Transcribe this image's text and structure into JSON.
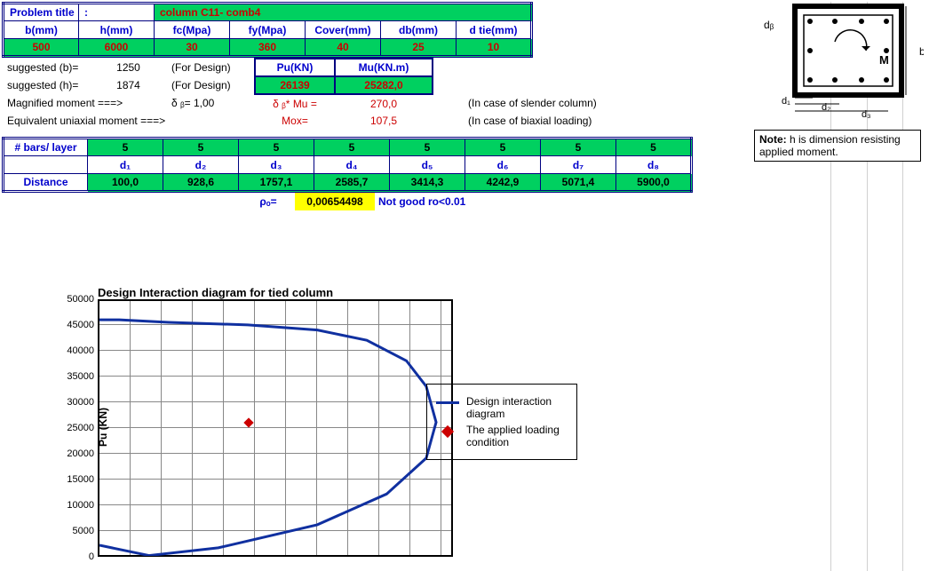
{
  "header": {
    "problem_label": "Problem title",
    "colon": ":",
    "problem_value": "column C11- comb4",
    "cols": [
      "b(mm)",
      "h(mm)",
      "fc(Mpa)",
      "fy(Mpa)",
      "Cover(mm)",
      "db(mm)",
      "d tie(mm)"
    ],
    "vals": [
      "500",
      "6000",
      "30",
      "360",
      "40",
      "25",
      "10"
    ]
  },
  "suggested": {
    "row1": {
      "label": "suggested (b)=",
      "val": "1250",
      "note": "(For Design)"
    },
    "row2": {
      "label": "suggested (h)=",
      "val": "1874",
      "note": "(For Design)"
    },
    "pu_label": "Pu(KN)",
    "mu_label": "Mu(KN.m)",
    "pu_val": "26139",
    "mu_val": "25282,0"
  },
  "moments": {
    "magnified_label": "Magnified moment ===>",
    "delta_b_label": "δ ᵦ=",
    "delta_b_val": "1,00",
    "dbMu_label": "δ ᵦ* Mu =",
    "dbMu_val": "270,0",
    "slender_note": "(In case of slender column)",
    "equiv_label": "Equivalent uniaxial moment ===>",
    "mox_label": "Mox=",
    "mox_val": "107,5",
    "biaxial_note": "(In case of biaxial loading)"
  },
  "bars": {
    "row_label": "# bars/ layer",
    "counts": [
      "5",
      "5",
      "5",
      "5",
      "5",
      "5",
      "5",
      "5"
    ],
    "d_labels": [
      "d₁",
      "d₂",
      "d₃",
      "d₄",
      "d₅",
      "d₆",
      "d₇",
      "d₈"
    ],
    "dist_label": "Distance",
    "distances": [
      "100,0",
      "928,6",
      "1757,1",
      "2585,7",
      "3414,3",
      "4242,9",
      "5071,4",
      "5900,0"
    ]
  },
  "rho": {
    "label": "ρₒ=",
    "value": "0,00654498",
    "msg": "Not good ro<0.01"
  },
  "chart_data": {
    "type": "line",
    "title": "Design Interaction diagram for tied column",
    "ylabel": "Pu (KN)",
    "ylim": [
      0,
      50000
    ],
    "yticks": [
      0,
      5000,
      10000,
      15000,
      20000,
      25000,
      30000,
      35000,
      40000,
      45000,
      50000
    ],
    "series": [
      {
        "name": "Design interaction diagram",
        "x": [
          0,
          2000,
          7000,
          15000,
          22000,
          27000,
          31000,
          33000,
          34000,
          33000,
          29000,
          22000,
          12000,
          5000,
          0
        ],
        "y": [
          46000,
          46000,
          45500,
          45000,
          44000,
          42000,
          38000,
          33000,
          26000,
          19000,
          12000,
          6000,
          1500,
          0,
          2000
        ]
      }
    ],
    "point": {
      "name": "The applied loading condition",
      "x": 15000,
      "y": 26000
    }
  },
  "legend": {
    "line": "Design  interaction diagram",
    "point": "The applied loading condition"
  },
  "note": {
    "prefix": "Note:",
    "text": " h is dimension resisting applied moment."
  },
  "diagram": {
    "db": "dᵦ",
    "d1": "d₁",
    "d2": "d₂",
    "d3": "d₃",
    "M": "M",
    "b": "b"
  }
}
